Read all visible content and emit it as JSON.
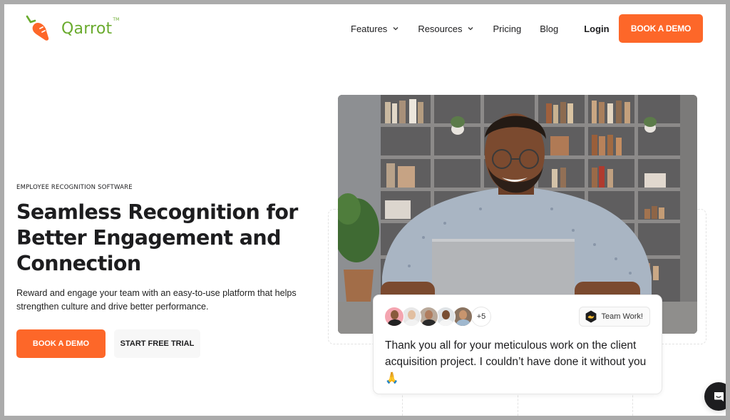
{
  "brand": {
    "name": "Qarrot",
    "trademark": "TM",
    "logo_icon": "carrot-icon",
    "primary_color": "#fd6729",
    "logo_text_color": "#6aab2e"
  },
  "nav": {
    "items": [
      {
        "label": "Features",
        "has_dropdown": true
      },
      {
        "label": "Resources",
        "has_dropdown": true
      },
      {
        "label": "Pricing",
        "has_dropdown": false
      },
      {
        "label": "Blog",
        "has_dropdown": false
      }
    ],
    "login_label": "Login",
    "cta_label": "BOOK A DEMO"
  },
  "hero": {
    "eyebrow": "EMPLOYEE RECOGNITION SOFTWARE",
    "headline": "Seamless Recognition for Better Engagement and Connection",
    "subtext": "Reward and engage your team with an easy-to-use platform that helps strengthen culture and drive better performance.",
    "primary_button": "BOOK A DEMO",
    "secondary_button": "START FREE TRIAL",
    "image_alt": "Smiling man with glasses working on a laptop in front of bookshelves"
  },
  "recognition_card": {
    "avatars": [
      {
        "bg": "#f4a5b0",
        "skin": "#8a5a3c",
        "shirt": "#222222"
      },
      {
        "bg": "#e8e8e8",
        "skin": "#e2bfa0",
        "shirt": "#f2f2f2"
      },
      {
        "bg": "#b9a99a",
        "skin": "#b07d5e",
        "shirt": "#2a2a2a"
      },
      {
        "bg": "#dfe3e6",
        "skin": "#7a4f34",
        "shirt": "#f5f5f5"
      },
      {
        "bg": "#8a7360",
        "skin": "#c8956e",
        "shirt": "#9fb8cf"
      }
    ],
    "more_count": "+5",
    "badge_label": "Team Work!",
    "badge_icon": "handshake-icon",
    "message": "Thank you all for your meticulous work on the client acquisition project. I couldn’t have done it without you 🙏"
  },
  "chat_widget": {
    "icon": "chat-icon"
  }
}
